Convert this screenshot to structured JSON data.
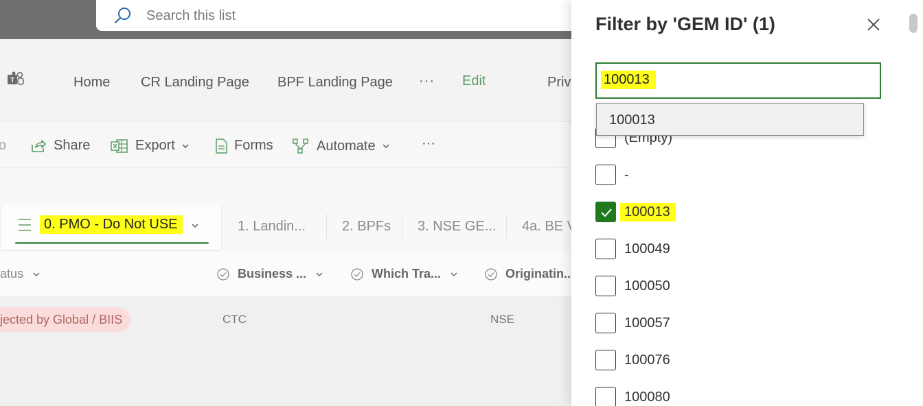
{
  "search": {
    "placeholder": "Search this list"
  },
  "site_nav": {
    "items": [
      "Home",
      "CR Landing Page",
      "BPF Landing Page"
    ],
    "more": "···",
    "edit": "Edit",
    "truncated": "Priv"
  },
  "command_bar": {
    "partial_left": "o",
    "share": "Share",
    "export": "Export",
    "forms": "Forms",
    "automate": "Automate",
    "more": "···"
  },
  "view_tabs": {
    "active": "0. PMO - Do Not USE",
    "others": [
      "1. Landin...",
      "2. BPFs",
      "3. NSE GE...",
      "4a. BE V"
    ]
  },
  "columns": {
    "status": "atus",
    "business": "Business ...",
    "which": "Which Tra...",
    "originating": "Originatin..."
  },
  "row": {
    "status": "jected by Global / BIIS",
    "business": "CTC",
    "originating": "NSE"
  },
  "filter_panel": {
    "title": "Filter by 'GEM ID' (1)",
    "input_value": "100013",
    "suggestion": "100013",
    "options": [
      {
        "label": "(Empty)",
        "checked": false,
        "highlight": false
      },
      {
        "label": "-",
        "checked": false,
        "highlight": false
      },
      {
        "label": "100013",
        "checked": true,
        "highlight": true
      },
      {
        "label": "100049",
        "checked": false,
        "highlight": false
      },
      {
        "label": "100050",
        "checked": false,
        "highlight": false
      },
      {
        "label": "100057",
        "checked": false,
        "highlight": false
      },
      {
        "label": "100076",
        "checked": false,
        "highlight": false
      },
      {
        "label": "100080",
        "checked": false,
        "highlight": false
      }
    ]
  },
  "colors": {
    "accent_green": "#1f7a1f",
    "highlight_yellow": "#ffff1a",
    "status_pill_bg": "#fbdcdc",
    "edit_link": "#5a9b65"
  }
}
